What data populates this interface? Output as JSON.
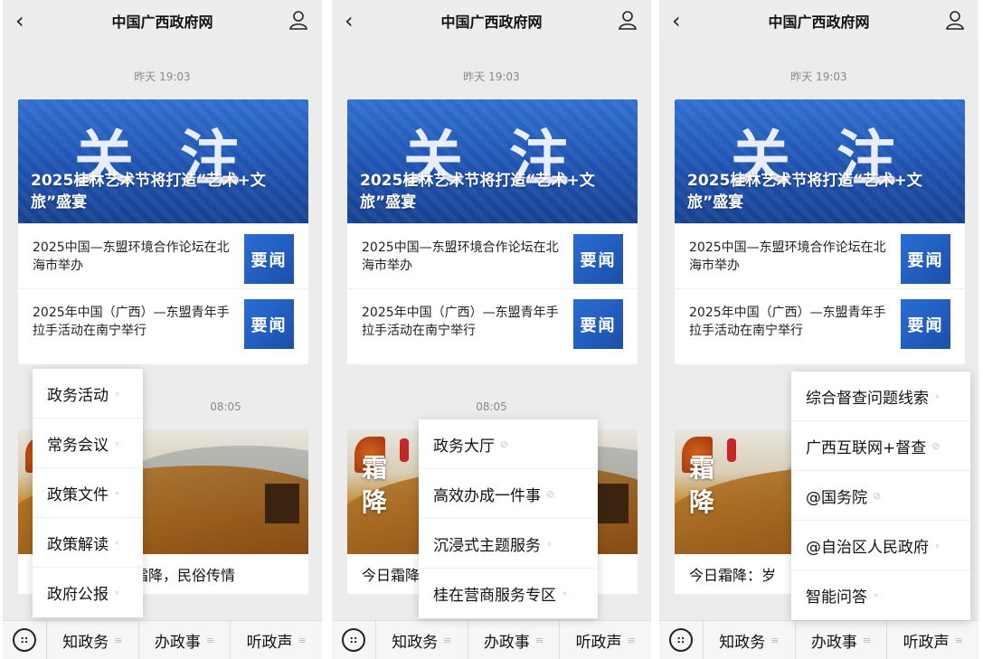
{
  "app": {
    "title": "中国广西政府网"
  },
  "feed": {
    "time1": "昨天 19:03",
    "banner_big": "关 注",
    "banner_headline": "2025桂林艺术节将打造“艺术+文旅”盛宴",
    "news": [
      {
        "text": "2025中国—东盟环境合作论坛在北海市举办",
        "badge": "要闻"
      },
      {
        "text": "2025年中国（广西）—东盟青年手拉手活动在南宁举行",
        "badge": "要闻"
      }
    ],
    "time2": "08:05",
    "photo_text": "霜降",
    "caption_p1": "今日霜降：岁至霜降，民俗传情",
    "caption_p2": "今日霜降",
    "caption_p3": "今日霜降：岁"
  },
  "bottom_tabs": [
    {
      "label": "知政务",
      "icon": "menu-lines-icon"
    },
    {
      "label": "办政事",
      "icon": "menu-lines-icon"
    },
    {
      "label": "听政声",
      "icon": "menu-lines-icon"
    }
  ],
  "keyboard_icon": "keyboard-icon",
  "menus": {
    "zhizhengwu": [
      "政务活动",
      "常务会议",
      "政策文件",
      "政策解读",
      "政府公报"
    ],
    "banzhengshi": [
      "政务大厅",
      "高效办成一件事",
      "沉浸式主题服务",
      "桂在营商服务专区"
    ],
    "tingzhengsheng": [
      "综合督查问题线索",
      "广西互联网+督查",
      "@国务院",
      "@自治区人民政府",
      "智能问答"
    ]
  },
  "colors": {
    "brand_blue": "#1e52b0",
    "bg": "#ececec"
  }
}
